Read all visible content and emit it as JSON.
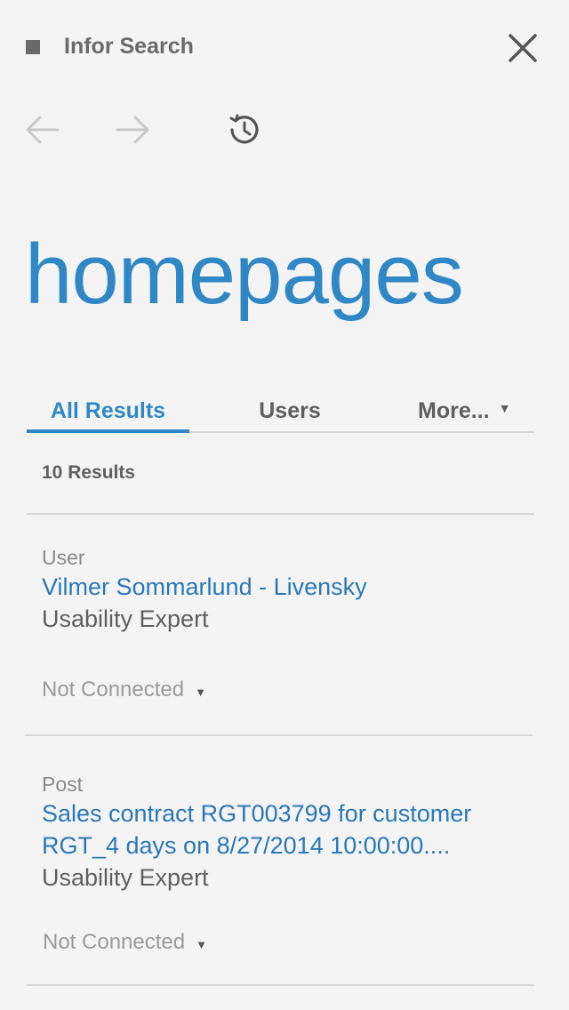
{
  "header": {
    "title": "Infor Search",
    "icons": {
      "app": "square-icon",
      "close": "close-icon"
    }
  },
  "nav": {
    "icons": [
      "back-arrow-icon",
      "forward-arrow-icon",
      "history-icon"
    ]
  },
  "search": {
    "term": "homepages"
  },
  "tabs": [
    {
      "label": "All Results",
      "active": true
    },
    {
      "label": "Users",
      "active": false
    },
    {
      "label": "More...",
      "active": false
    }
  ],
  "results_count": "10 Results",
  "results": [
    {
      "type": "User",
      "title": "Vilmer Sommarlund - Livensky",
      "subtitle": "Usability Expert",
      "status": "Not Connected"
    },
    {
      "type": "Post",
      "title_line1": "Sales contract RGT003799 for customer",
      "title_line2": "RGT_4 days on 8/27/2014 10:00:00....",
      "subtitle": "Usability Expert",
      "status": "Not Connected"
    }
  ],
  "colors": {
    "accent": "#2f88c5",
    "link": "#2a78b8",
    "text": "#5f5f5f",
    "muted": "#8a8a8a",
    "background": "#f4f4f4"
  }
}
